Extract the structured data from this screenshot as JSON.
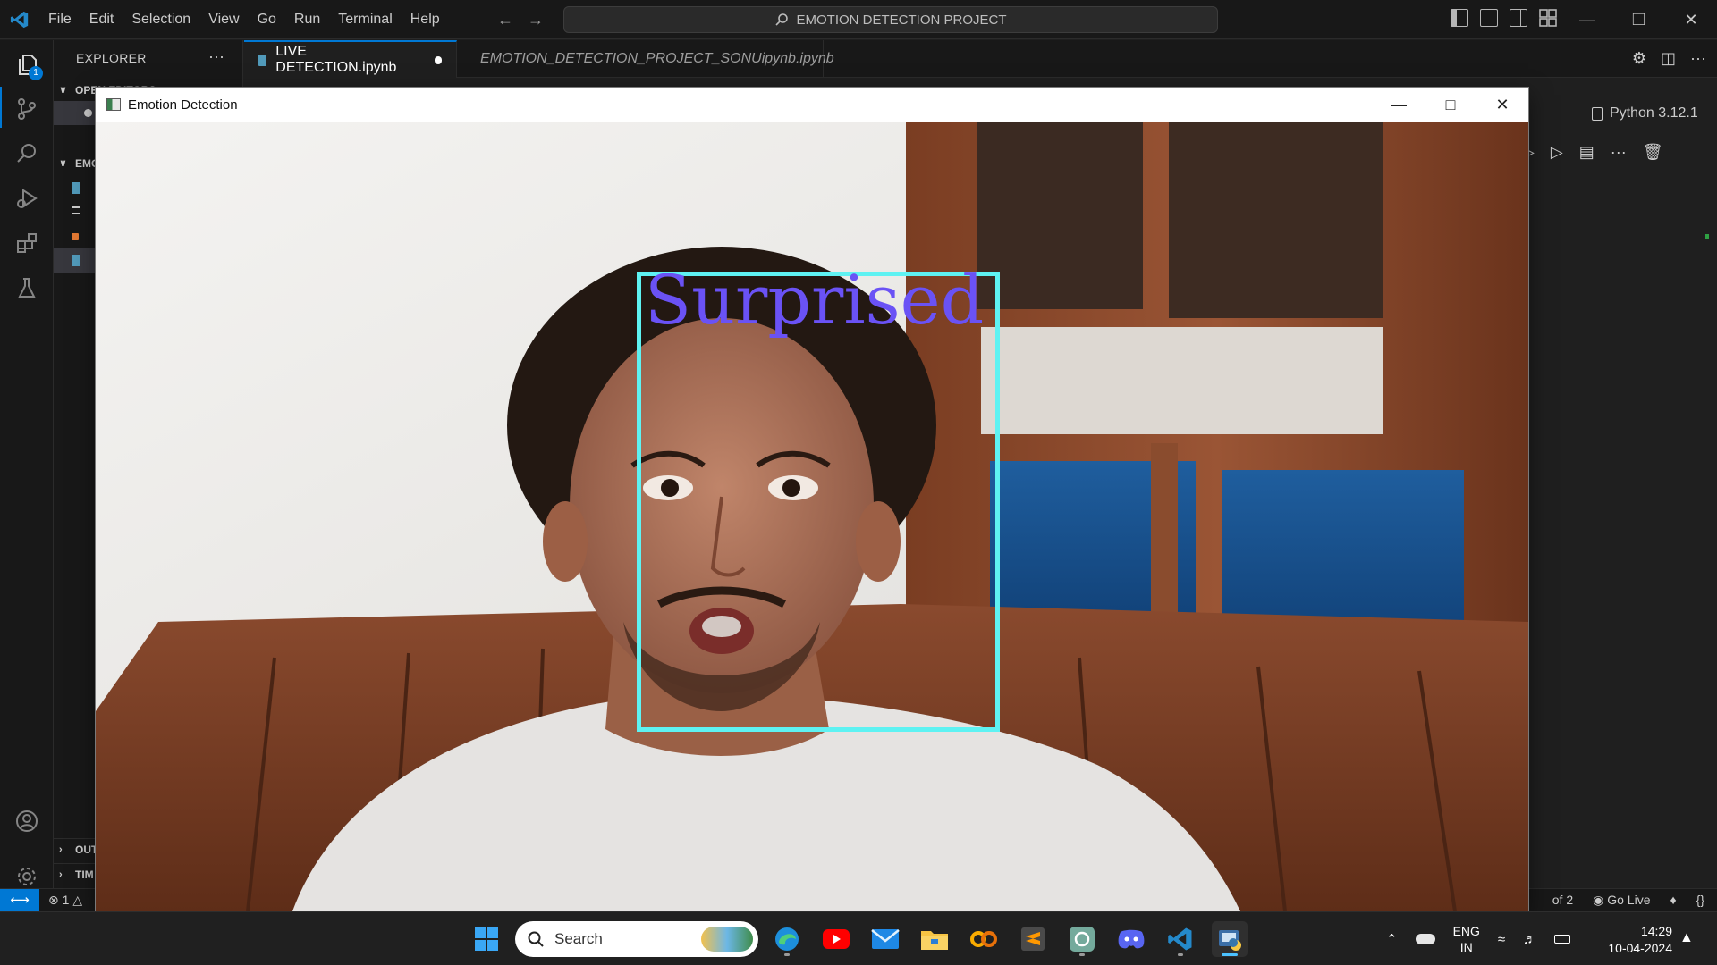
{
  "vscode": {
    "menu": [
      "File",
      "Edit",
      "Selection",
      "View",
      "Go",
      "Run",
      "Terminal",
      "Help"
    ],
    "command_center": "EMOTION DETECTION PROJECT",
    "activity_badge": "1",
    "sidebar": {
      "title": "EXPLORER",
      "open_editors": "OPEN EDITORS",
      "folder": "EMO",
      "outline": "OUT",
      "timeline": "TIM"
    },
    "tabs": [
      {
        "label": "LIVE DETECTION.ipynb"
      },
      {
        "label": "EMOTION_DETECTION_PROJECT_SONUipynb.ipynb"
      }
    ],
    "kernel": "Python 3.12.1",
    "status": {
      "problems": "1",
      "pages": "of 2",
      "go_live": "Go Live"
    }
  },
  "emotion_window": {
    "title": "Emotion Detection",
    "detected_emotion": "Surprised",
    "box_color": "#5ef2f2",
    "label_color": "#6a52f5"
  },
  "taskbar": {
    "search_placeholder": "Search",
    "lang_top": "ENG",
    "lang_bottom": "IN",
    "time": "14:29",
    "date": "10-04-2024"
  },
  "colors": {
    "accent": "#0078d4",
    "editor_bg": "#1f1f1f",
    "chrome_bg": "#181818"
  }
}
